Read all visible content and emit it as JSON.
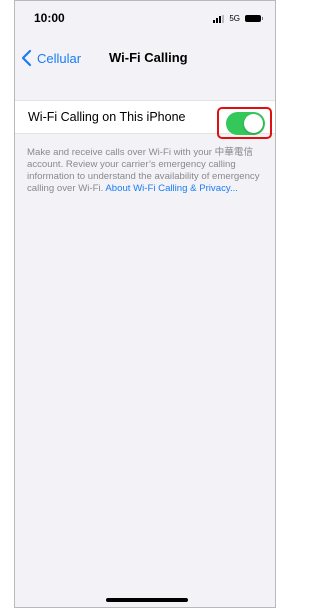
{
  "status_bar": {
    "time": "10:00",
    "network": "5G",
    "icons": [
      "signal-bars-icon",
      "battery-icon"
    ]
  },
  "nav": {
    "back_label": "Cellular",
    "back_icon": "chevron-left-icon",
    "title": "Wi-Fi Calling"
  },
  "setting": {
    "label": "Wi-Fi Calling on This iPhone",
    "toggle_on": true
  },
  "footer": {
    "description": "Make and receive calls over Wi-Fi with your 中華電信 account. Review your carrier’s emergency calling information to understand the availability of emergency calling over Wi-Fi.",
    "link_text": "About Wi-Fi Calling & Privacy..."
  },
  "colors": {
    "accent": "#1a7cf5",
    "toggle_on": "#34c759",
    "highlight": "#e01010",
    "background": "#f2f2f7",
    "footer_text": "#8a8a8e"
  }
}
